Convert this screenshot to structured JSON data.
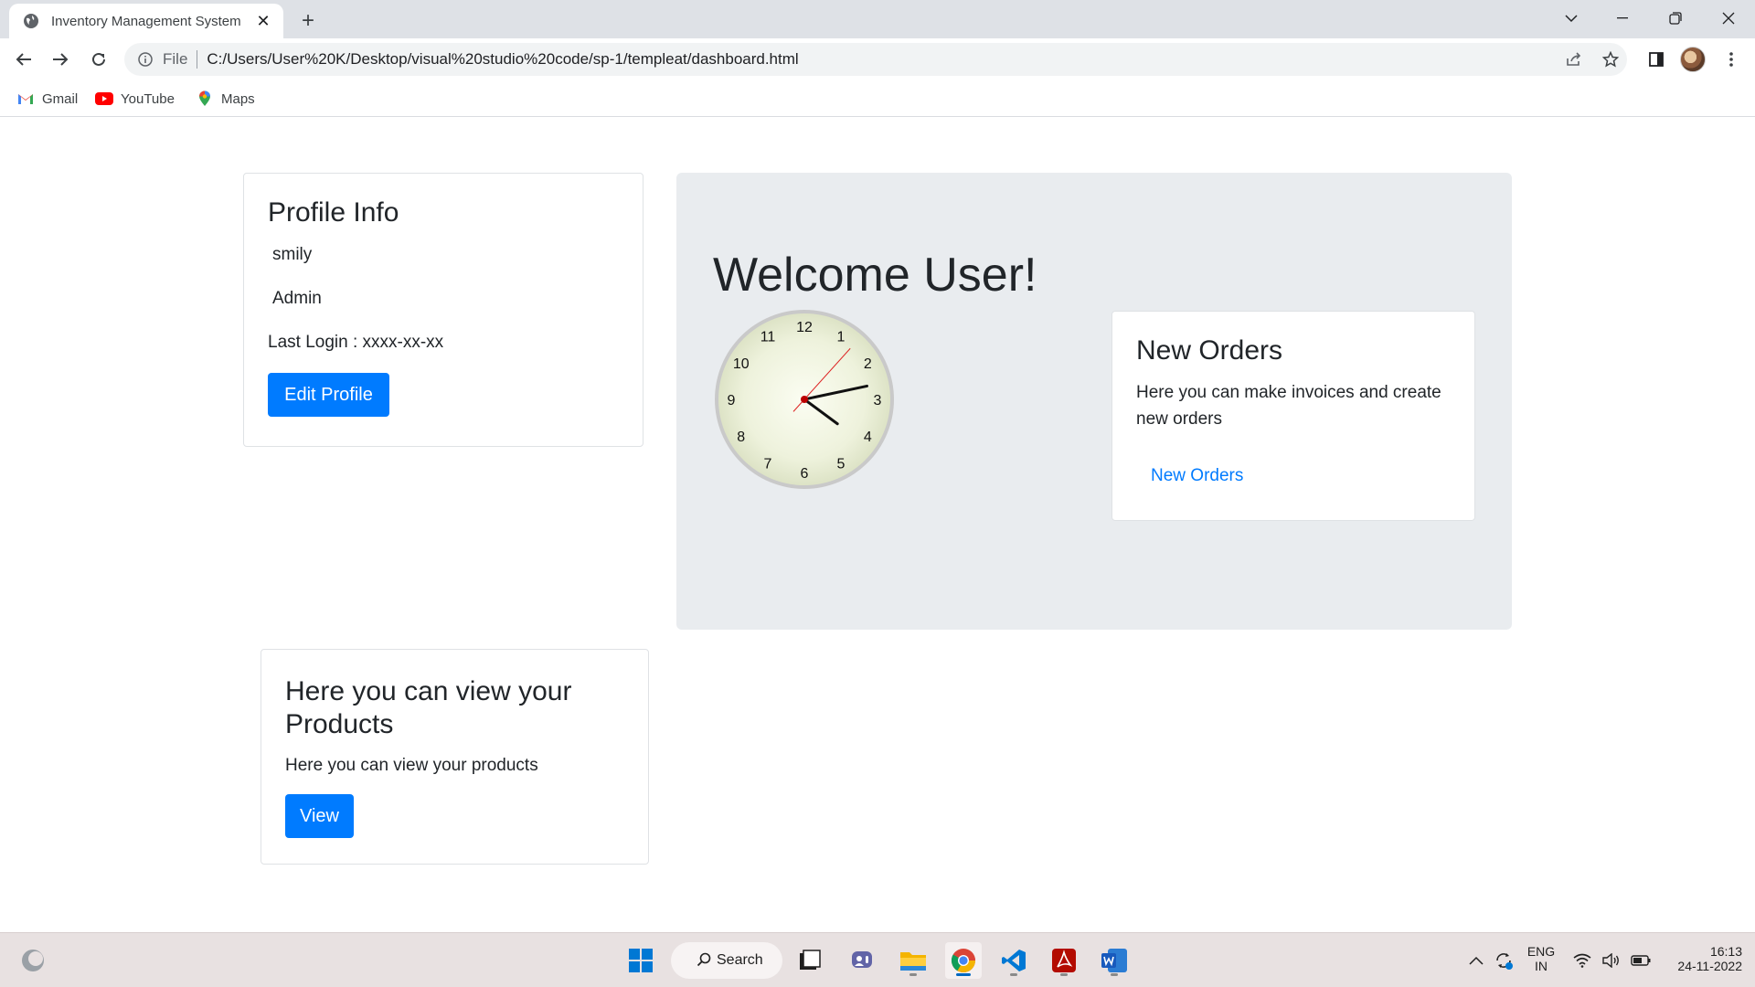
{
  "browser": {
    "tab_title": "Inventory Management System",
    "url_scheme_label": "File",
    "url": "C:/Users/User%20K/Desktop/visual%20studio%20code/sp-1/templeat/dashboard.html",
    "bookmarks": [
      {
        "label": "Gmail",
        "icon": "gmail-icon"
      },
      {
        "label": "YouTube",
        "icon": "youtube-icon"
      },
      {
        "label": "Maps",
        "icon": "maps-icon"
      }
    ]
  },
  "profile": {
    "title": "Profile Info",
    "name": "smily",
    "role": "Admin",
    "last_login": "Last Login : xxxx-xx-xx",
    "edit_button": "Edit Profile"
  },
  "welcome": {
    "heading": "Welcome User!",
    "clock": {
      "numbers": [
        "12",
        "1",
        "2",
        "3",
        "4",
        "5",
        "6",
        "7",
        "8",
        "9",
        "10",
        "11"
      ],
      "time": {
        "hour": 4,
        "minute": 13,
        "second": 7
      }
    }
  },
  "orders": {
    "title": "New Orders",
    "text": "Here you can make invoices and create new orders",
    "link": "New Orders"
  },
  "products": {
    "title": "Here you can view your Products",
    "text": "Here you can view your products",
    "button": "View"
  },
  "taskbar": {
    "search_label": "Search",
    "lang_top": "ENG",
    "lang_bottom": "IN",
    "time": "16:13",
    "date": "24-11-2022"
  },
  "colors": {
    "primary": "#007bff",
    "jumbotron": "#e9ecef"
  }
}
